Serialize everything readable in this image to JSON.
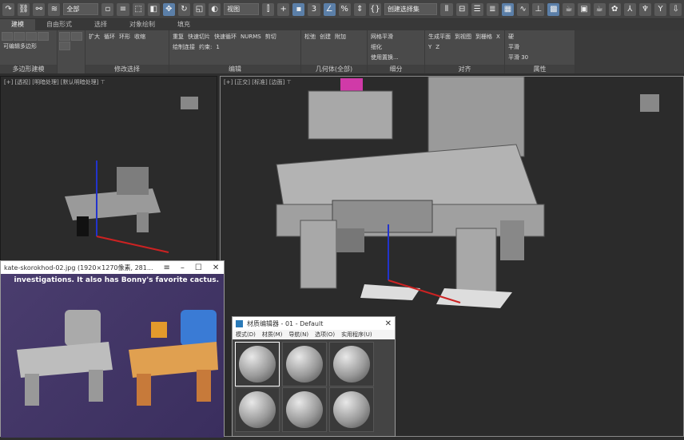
{
  "toolbar": {
    "selection_filter": "全部",
    "ref_coord": "视图",
    "named_set": "创建选择集",
    "snap_label": "3"
  },
  "tabs": [
    {
      "label": "建模",
      "active": true
    },
    {
      "label": "自由形式"
    },
    {
      "label": "选择"
    },
    {
      "label": "对象绘制"
    },
    {
      "label": "填充"
    }
  ],
  "ribbon": {
    "poly": {
      "title": "多边形建模",
      "item": "可编辑多边形"
    },
    "modsel": {
      "title": "修改选择",
      "grow": "扩大",
      "shrink": "收缩",
      "loop": "循环",
      "ring": "环形"
    },
    "edit": {
      "title": "编辑",
      "repeat": "重复",
      "quickslice": "快速切片",
      "quickloop": "快速循环",
      "nurms": "NURMS",
      "cut": "剪切",
      "paintconnect": "绘制连接",
      "constrain": "约束:",
      "spinner": "1"
    },
    "geom": {
      "title": "几何体(全部)",
      "relax": "松弛",
      "create": "创建",
      "attach": "附加"
    },
    "subdiv": {
      "title": "细分",
      "meshsmooth": "网格平滑",
      "tessellate": "细化",
      "useDisp": "使用置换..."
    },
    "align": {
      "title": "对齐",
      "make_planar": "生成平面",
      "to_view": "到视图",
      "to_grid": "到栅格",
      "x": "X",
      "y": "Y",
      "z": "Z"
    },
    "props": {
      "title": "属性",
      "hard": "硬",
      "smooth": "平滑",
      "smooth30": "平滑 30"
    }
  },
  "viewports": {
    "left_label": "[+] [透视] [明暗处理] [默认明暗处理] ⊤",
    "main_label": "[+] [正交] [标准] [边面] ⊤"
  },
  "image_viewer": {
    "title": "kate-skorokhod-02.jpg  (1920×1270像素, 281...",
    "caption": "investigations. It also has Bonny's favorite cactus."
  },
  "material_editor": {
    "title": "材质编辑器 - 01 - Default",
    "menus": [
      "模式(D)",
      "材质(M)",
      "导航(N)",
      "选项(O)",
      "实用程序(U)"
    ]
  }
}
